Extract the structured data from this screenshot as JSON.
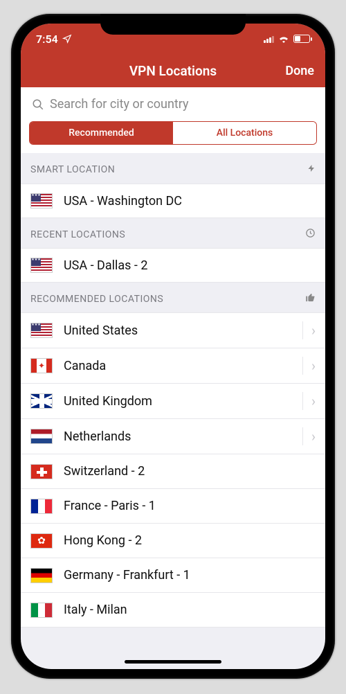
{
  "statusbar": {
    "time": "7:54"
  },
  "navbar": {
    "title": "VPN Locations",
    "done": "Done"
  },
  "search": {
    "placeholder": "Search for city or country"
  },
  "tabs": {
    "recommended": "Recommended",
    "all": "All Locations"
  },
  "sections": {
    "smart": {
      "header": "SMART LOCATION",
      "items": [
        {
          "flag": "us",
          "label": "USA - Washington DC",
          "chev": false
        }
      ]
    },
    "recent": {
      "header": "RECENT LOCATIONS",
      "items": [
        {
          "flag": "us",
          "label": "USA - Dallas - 2",
          "chev": false
        }
      ]
    },
    "recommended": {
      "header": "RECOMMENDED LOCATIONS",
      "items": [
        {
          "flag": "us",
          "label": "United States",
          "chev": true
        },
        {
          "flag": "ca",
          "label": "Canada",
          "chev": true
        },
        {
          "flag": "uk",
          "label": "United Kingdom",
          "chev": true
        },
        {
          "flag": "nl",
          "label": "Netherlands",
          "chev": true
        },
        {
          "flag": "ch",
          "label": "Switzerland - 2",
          "chev": false
        },
        {
          "flag": "fr",
          "label": "France - Paris - 1",
          "chev": false
        },
        {
          "flag": "hk",
          "label": "Hong Kong - 2",
          "chev": false
        },
        {
          "flag": "de",
          "label": "Germany - Frankfurt - 1",
          "chev": false
        },
        {
          "flag": "it",
          "label": "Italy - Milan",
          "chev": false
        }
      ]
    }
  }
}
